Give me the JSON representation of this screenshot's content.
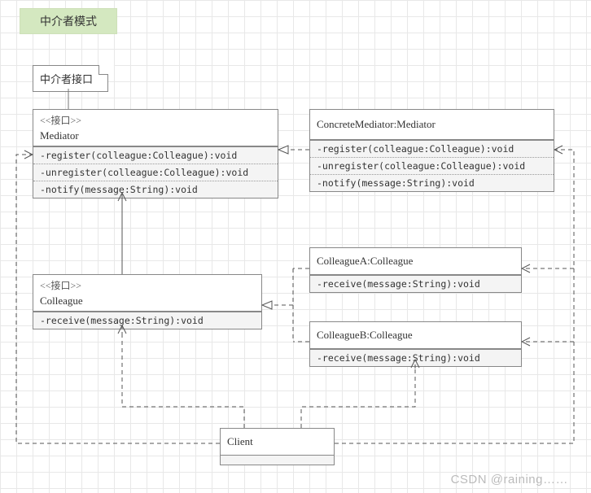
{
  "title": "中介者模式",
  "note": {
    "label": "中介者接口"
  },
  "mediator": {
    "stereo": "<<接口>>",
    "name": "Mediator",
    "methods": [
      "-register(colleague:Colleague):void",
      "-unregister(colleague:Colleague):void",
      "-notify(message:String):void"
    ]
  },
  "concreteMediator": {
    "name": "ConcreteMediator:Mediator",
    "methods": [
      "-register(colleague:Colleague):void",
      "-unregister(colleague:Colleague):void",
      "-notify(message:String):void"
    ]
  },
  "colleague": {
    "stereo": "<<接口>>",
    "name": "Colleague",
    "method": "-receive(message:String):void"
  },
  "colleagueA": {
    "name": "ColleagueA:Colleague",
    "method": "-receive(message:String):void"
  },
  "colleagueB": {
    "name": "ColleagueB:Colleague",
    "method": "-receive(message:String):void"
  },
  "client": {
    "name": "Client"
  },
  "watermark": "CSDN @raining……"
}
